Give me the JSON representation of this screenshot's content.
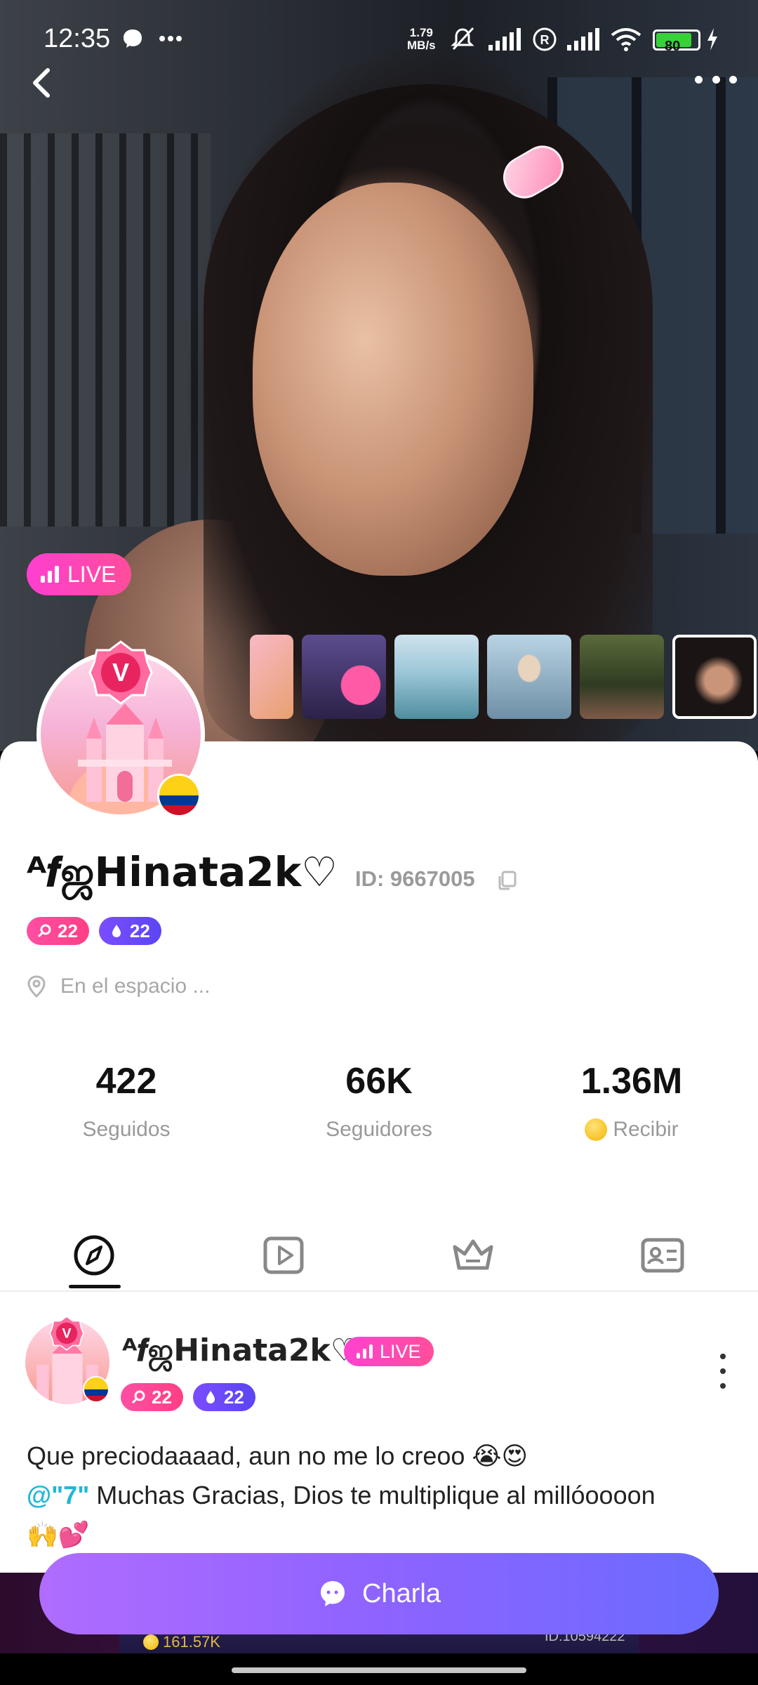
{
  "status_bar": {
    "time": "12:35",
    "net_speed_value": "1.79",
    "net_speed_unit": "MB/s",
    "battery": "80"
  },
  "hero": {
    "live_label": "LIVE"
  },
  "profile": {
    "name": "ᴬ𝒇ஜHinata2k♡",
    "id_label": "ID: 9667005",
    "level_wealth": "22",
    "level_charm": "22",
    "location": "En el espacio ...",
    "country_flag": "colombia"
  },
  "stats": [
    {
      "value": "422",
      "label": "Seguidos"
    },
    {
      "value": "66K",
      "label": "Seguidores"
    },
    {
      "value": "1.36M",
      "label": "Recibir"
    }
  ],
  "tabs": [
    {
      "icon": "compass-icon"
    },
    {
      "icon": "video-play-icon"
    },
    {
      "icon": "crown-icon"
    },
    {
      "icon": "id-card-icon"
    }
  ],
  "post": {
    "author": "ᴬ𝒇ஜHinata2k♡",
    "live_label": "LIVE",
    "level_wealth": "22",
    "level_charm": "22",
    "line1": "Que preciodaaaad, aun no me lo creoo 😭😍",
    "mention": "@\"7\"",
    "line2": " Muchas Gracias, Dios te multiplique al millóoooon",
    "line3": "🙌💕"
  },
  "bottom": {
    "coins": "161.57K",
    "room_id": "ID:10594222",
    "chat_button": "Charla"
  },
  "colors": {
    "live_pink": "#ff3fd0",
    "charm_purple": "#5b45f3",
    "wealth_pink": "#ff4fa3",
    "mention": "#1fb8d6",
    "chat_button": "#8e63ff"
  }
}
